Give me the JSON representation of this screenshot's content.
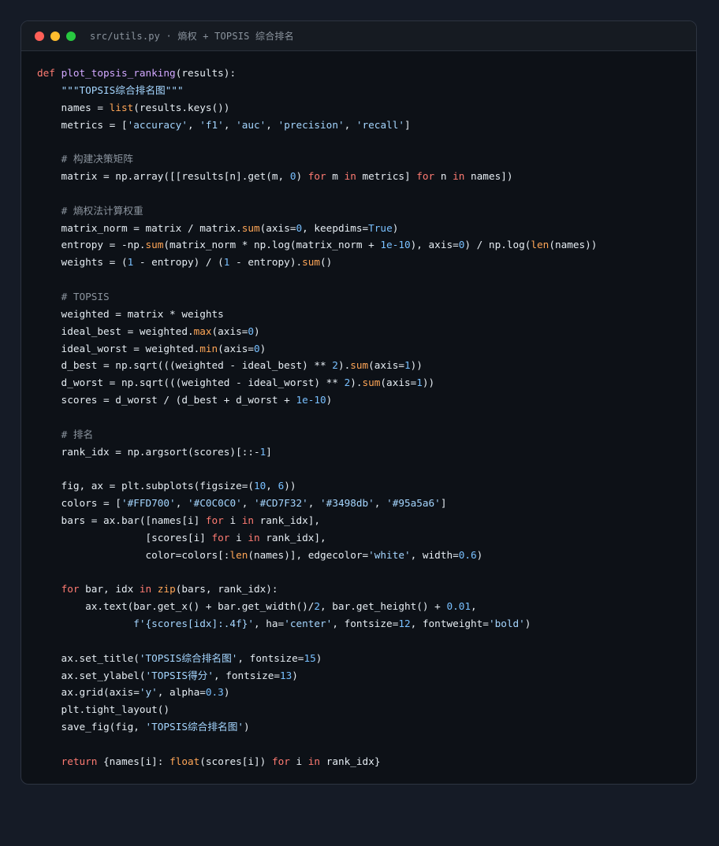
{
  "window": {
    "title": "src/utils.py · 熵权 + TOPSIS 综合排名"
  },
  "code": {
    "lines": [
      [
        {
          "t": "k",
          "v": "def"
        },
        {
          "t": "",
          "v": " "
        },
        {
          "t": "f",
          "v": "plot_topsis_ranking"
        },
        {
          "t": "",
          "v": "(results):"
        }
      ],
      [
        {
          "t": "",
          "v": "    "
        },
        {
          "t": "s",
          "v": "\"\"\"TOPSIS综合排名图\"\"\""
        }
      ],
      [
        {
          "t": "",
          "v": "    names = "
        },
        {
          "t": "b",
          "v": "list"
        },
        {
          "t": "",
          "v": "(results.keys())"
        }
      ],
      [
        {
          "t": "",
          "v": "    metrics = ["
        },
        {
          "t": "s",
          "v": "'accuracy'"
        },
        {
          "t": "",
          "v": ", "
        },
        {
          "t": "s",
          "v": "'f1'"
        },
        {
          "t": "",
          "v": ", "
        },
        {
          "t": "s",
          "v": "'auc'"
        },
        {
          "t": "",
          "v": ", "
        },
        {
          "t": "s",
          "v": "'precision'"
        },
        {
          "t": "",
          "v": ", "
        },
        {
          "t": "s",
          "v": "'recall'"
        },
        {
          "t": "",
          "v": "]"
        }
      ],
      [],
      [
        {
          "t": "",
          "v": "    "
        },
        {
          "t": "c",
          "v": "# 构建决策矩阵"
        }
      ],
      [
        {
          "t": "",
          "v": "    matrix = np.array([[results[n].get(m, "
        },
        {
          "t": "n",
          "v": "0"
        },
        {
          "t": "",
          "v": ") "
        },
        {
          "t": "k",
          "v": "for"
        },
        {
          "t": "",
          "v": " m "
        },
        {
          "t": "k",
          "v": "in"
        },
        {
          "t": "",
          "v": " metrics] "
        },
        {
          "t": "k",
          "v": "for"
        },
        {
          "t": "",
          "v": " n "
        },
        {
          "t": "k",
          "v": "in"
        },
        {
          "t": "",
          "v": " names])"
        }
      ],
      [],
      [
        {
          "t": "",
          "v": "    "
        },
        {
          "t": "c",
          "v": "# 熵权法计算权重"
        }
      ],
      [
        {
          "t": "",
          "v": "    matrix_norm = matrix / matrix."
        },
        {
          "t": "b",
          "v": "sum"
        },
        {
          "t": "",
          "v": "(axis="
        },
        {
          "t": "n",
          "v": "0"
        },
        {
          "t": "",
          "v": ", keepdims="
        },
        {
          "t": "n",
          "v": "True"
        },
        {
          "t": "",
          "v": ")"
        }
      ],
      [
        {
          "t": "",
          "v": "    entropy = -np."
        },
        {
          "t": "b",
          "v": "sum"
        },
        {
          "t": "",
          "v": "(matrix_norm * np.log(matrix_norm + "
        },
        {
          "t": "n",
          "v": "1e-10"
        },
        {
          "t": "",
          "v": "), axis="
        },
        {
          "t": "n",
          "v": "0"
        },
        {
          "t": "",
          "v": ") / np.log("
        },
        {
          "t": "b",
          "v": "len"
        },
        {
          "t": "",
          "v": "(names))"
        }
      ],
      [
        {
          "t": "",
          "v": "    weights = ("
        },
        {
          "t": "n",
          "v": "1"
        },
        {
          "t": "",
          "v": " - entropy) / ("
        },
        {
          "t": "n",
          "v": "1"
        },
        {
          "t": "",
          "v": " - entropy)."
        },
        {
          "t": "b",
          "v": "sum"
        },
        {
          "t": "",
          "v": "()"
        }
      ],
      [],
      [
        {
          "t": "",
          "v": "    "
        },
        {
          "t": "c",
          "v": "# TOPSIS"
        }
      ],
      [
        {
          "t": "",
          "v": "    weighted = matrix * weights"
        }
      ],
      [
        {
          "t": "",
          "v": "    ideal_best = weighted."
        },
        {
          "t": "b",
          "v": "max"
        },
        {
          "t": "",
          "v": "(axis="
        },
        {
          "t": "n",
          "v": "0"
        },
        {
          "t": "",
          "v": ")"
        }
      ],
      [
        {
          "t": "",
          "v": "    ideal_worst = weighted."
        },
        {
          "t": "b",
          "v": "min"
        },
        {
          "t": "",
          "v": "(axis="
        },
        {
          "t": "n",
          "v": "0"
        },
        {
          "t": "",
          "v": ")"
        }
      ],
      [
        {
          "t": "",
          "v": "    d_best = np.sqrt(((weighted - ideal_best) ** "
        },
        {
          "t": "n",
          "v": "2"
        },
        {
          "t": "",
          "v": ")."
        },
        {
          "t": "b",
          "v": "sum"
        },
        {
          "t": "",
          "v": "(axis="
        },
        {
          "t": "n",
          "v": "1"
        },
        {
          "t": "",
          "v": "))"
        }
      ],
      [
        {
          "t": "",
          "v": "    d_worst = np.sqrt(((weighted - ideal_worst) ** "
        },
        {
          "t": "n",
          "v": "2"
        },
        {
          "t": "",
          "v": ")."
        },
        {
          "t": "b",
          "v": "sum"
        },
        {
          "t": "",
          "v": "(axis="
        },
        {
          "t": "n",
          "v": "1"
        },
        {
          "t": "",
          "v": "))"
        }
      ],
      [
        {
          "t": "",
          "v": "    scores = d_worst / (d_best + d_worst + "
        },
        {
          "t": "n",
          "v": "1e-10"
        },
        {
          "t": "",
          "v": ")"
        }
      ],
      [],
      [
        {
          "t": "",
          "v": "    "
        },
        {
          "t": "c",
          "v": "# 排名"
        }
      ],
      [
        {
          "t": "",
          "v": "    rank_idx = np.argsort(scores)[::-"
        },
        {
          "t": "n",
          "v": "1"
        },
        {
          "t": "",
          "v": "]"
        }
      ],
      [],
      [
        {
          "t": "",
          "v": "    fig, ax = plt.subplots(figsize=("
        },
        {
          "t": "n",
          "v": "10"
        },
        {
          "t": "",
          "v": ", "
        },
        {
          "t": "n",
          "v": "6"
        },
        {
          "t": "",
          "v": "))"
        }
      ],
      [
        {
          "t": "",
          "v": "    colors = ["
        },
        {
          "t": "s",
          "v": "'#FFD700'"
        },
        {
          "t": "",
          "v": ", "
        },
        {
          "t": "s",
          "v": "'#C0C0C0'"
        },
        {
          "t": "",
          "v": ", "
        },
        {
          "t": "s",
          "v": "'#CD7F32'"
        },
        {
          "t": "",
          "v": ", "
        },
        {
          "t": "s",
          "v": "'#3498db'"
        },
        {
          "t": "",
          "v": ", "
        },
        {
          "t": "s",
          "v": "'#95a5a6'"
        },
        {
          "t": "",
          "v": "]"
        }
      ],
      [
        {
          "t": "",
          "v": "    bars = ax.bar([names[i] "
        },
        {
          "t": "k",
          "v": "for"
        },
        {
          "t": "",
          "v": " i "
        },
        {
          "t": "k",
          "v": "in"
        },
        {
          "t": "",
          "v": " rank_idx],"
        }
      ],
      [
        {
          "t": "",
          "v": "                  [scores[i] "
        },
        {
          "t": "k",
          "v": "for"
        },
        {
          "t": "",
          "v": " i "
        },
        {
          "t": "k",
          "v": "in"
        },
        {
          "t": "",
          "v": " rank_idx],"
        }
      ],
      [
        {
          "t": "",
          "v": "                  color=colors[:"
        },
        {
          "t": "b",
          "v": "len"
        },
        {
          "t": "",
          "v": "(names)], edgecolor="
        },
        {
          "t": "s",
          "v": "'white'"
        },
        {
          "t": "",
          "v": ", width="
        },
        {
          "t": "n",
          "v": "0.6"
        },
        {
          "t": "",
          "v": ")"
        }
      ],
      [],
      [
        {
          "t": "",
          "v": "    "
        },
        {
          "t": "k",
          "v": "for"
        },
        {
          "t": "",
          "v": " bar, idx "
        },
        {
          "t": "k",
          "v": "in"
        },
        {
          "t": "",
          "v": " "
        },
        {
          "t": "b",
          "v": "zip"
        },
        {
          "t": "",
          "v": "(bars, rank_idx):"
        }
      ],
      [
        {
          "t": "",
          "v": "        ax.text(bar.get_x() + bar.get_width()/"
        },
        {
          "t": "n",
          "v": "2"
        },
        {
          "t": "",
          "v": ", bar.get_height() + "
        },
        {
          "t": "n",
          "v": "0.01"
        },
        {
          "t": "",
          "v": ","
        }
      ],
      [
        {
          "t": "",
          "v": "                "
        },
        {
          "t": "s",
          "v": "f'{scores[idx]:.4f}'"
        },
        {
          "t": "",
          "v": ", ha="
        },
        {
          "t": "s",
          "v": "'center'"
        },
        {
          "t": "",
          "v": ", fontsize="
        },
        {
          "t": "n",
          "v": "12"
        },
        {
          "t": "",
          "v": ", fontweight="
        },
        {
          "t": "s",
          "v": "'bold'"
        },
        {
          "t": "",
          "v": ")"
        }
      ],
      [],
      [
        {
          "t": "",
          "v": "    ax.set_title("
        },
        {
          "t": "s",
          "v": "'TOPSIS综合排名图'"
        },
        {
          "t": "",
          "v": ", fontsize="
        },
        {
          "t": "n",
          "v": "15"
        },
        {
          "t": "",
          "v": ")"
        }
      ],
      [
        {
          "t": "",
          "v": "    ax.set_ylabel("
        },
        {
          "t": "s",
          "v": "'TOPSIS得分'"
        },
        {
          "t": "",
          "v": ", fontsize="
        },
        {
          "t": "n",
          "v": "13"
        },
        {
          "t": "",
          "v": ")"
        }
      ],
      [
        {
          "t": "",
          "v": "    ax.grid(axis="
        },
        {
          "t": "s",
          "v": "'y'"
        },
        {
          "t": "",
          "v": ", alpha="
        },
        {
          "t": "n",
          "v": "0.3"
        },
        {
          "t": "",
          "v": ")"
        }
      ],
      [
        {
          "t": "",
          "v": "    plt.tight_layout()"
        }
      ],
      [
        {
          "t": "",
          "v": "    save_fig(fig, "
        },
        {
          "t": "s",
          "v": "'TOPSIS综合排名图'"
        },
        {
          "t": "",
          "v": ")"
        }
      ],
      [],
      [
        {
          "t": "",
          "v": "    "
        },
        {
          "t": "k",
          "v": "return"
        },
        {
          "t": "",
          "v": " {names[i]: "
        },
        {
          "t": "b",
          "v": "float"
        },
        {
          "t": "",
          "v": "(scores[i]) "
        },
        {
          "t": "k",
          "v": "for"
        },
        {
          "t": "",
          "v": " i "
        },
        {
          "t": "k",
          "v": "in"
        },
        {
          "t": "",
          "v": " rank_idx}"
        }
      ]
    ]
  }
}
